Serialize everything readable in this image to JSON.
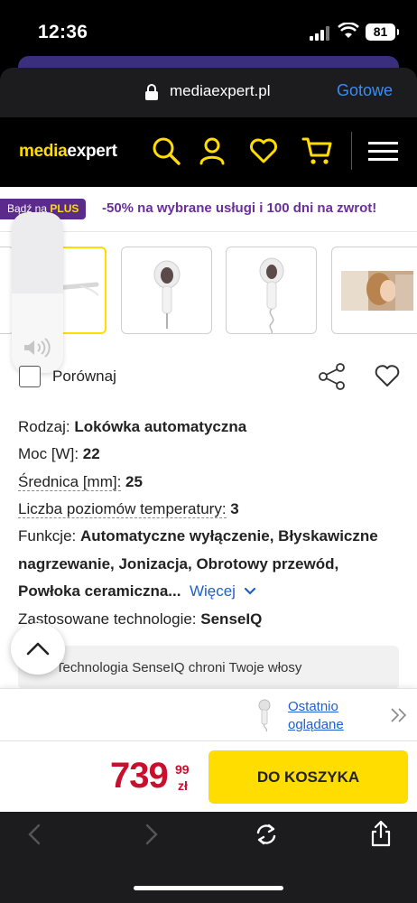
{
  "status": {
    "time": "12:36",
    "battery": "81"
  },
  "browser": {
    "domain": "mediaexpert.pl",
    "done_label": "Gotowe"
  },
  "site": {
    "logo_part1": "media",
    "logo_part2": "expert"
  },
  "promo": {
    "badge_prefix": "Bądź na",
    "badge_brand": "PLUS",
    "text": "-50% na wybrane usługi i 100 dni na zwrot!"
  },
  "product": {
    "compare_label": "Porównaj",
    "specs": {
      "type_label": "Rodzaj:",
      "type_value": "Lokówka automatyczna",
      "power_label": "Moc [W]:",
      "power_value": "22",
      "diameter_label": "Średnica [mm]:",
      "diameter_value": "25",
      "temp_label": "Liczba poziomów temperatury:",
      "temp_value": "3",
      "func_label": "Funkcje:",
      "func_line1": "Automatyczne wyłączenie, Błyskawiczne",
      "func_line2": "nagrzewanie, Jonizacja, Obrotowy przewód,",
      "func_line3": "Powłoka ceramiczna...",
      "more_label": "Więcej",
      "tech_label": "Zastosowane technologie:",
      "tech_value": "SenseIQ"
    },
    "tech_banner": "Technologia SenseIQ chroni Twoje włosy"
  },
  "recent": {
    "line1": "Ostatnio",
    "line2": "oglądane"
  },
  "price": {
    "main": "739",
    "cents": "99",
    "currency": "zł"
  },
  "cart_button": "DO KOSZYKA",
  "colors": {
    "brand_yellow": "#ffdd00",
    "price_red": "#c8102e",
    "link_blue": "#1f5fd1",
    "promo_purple": "#5b2b8c"
  }
}
